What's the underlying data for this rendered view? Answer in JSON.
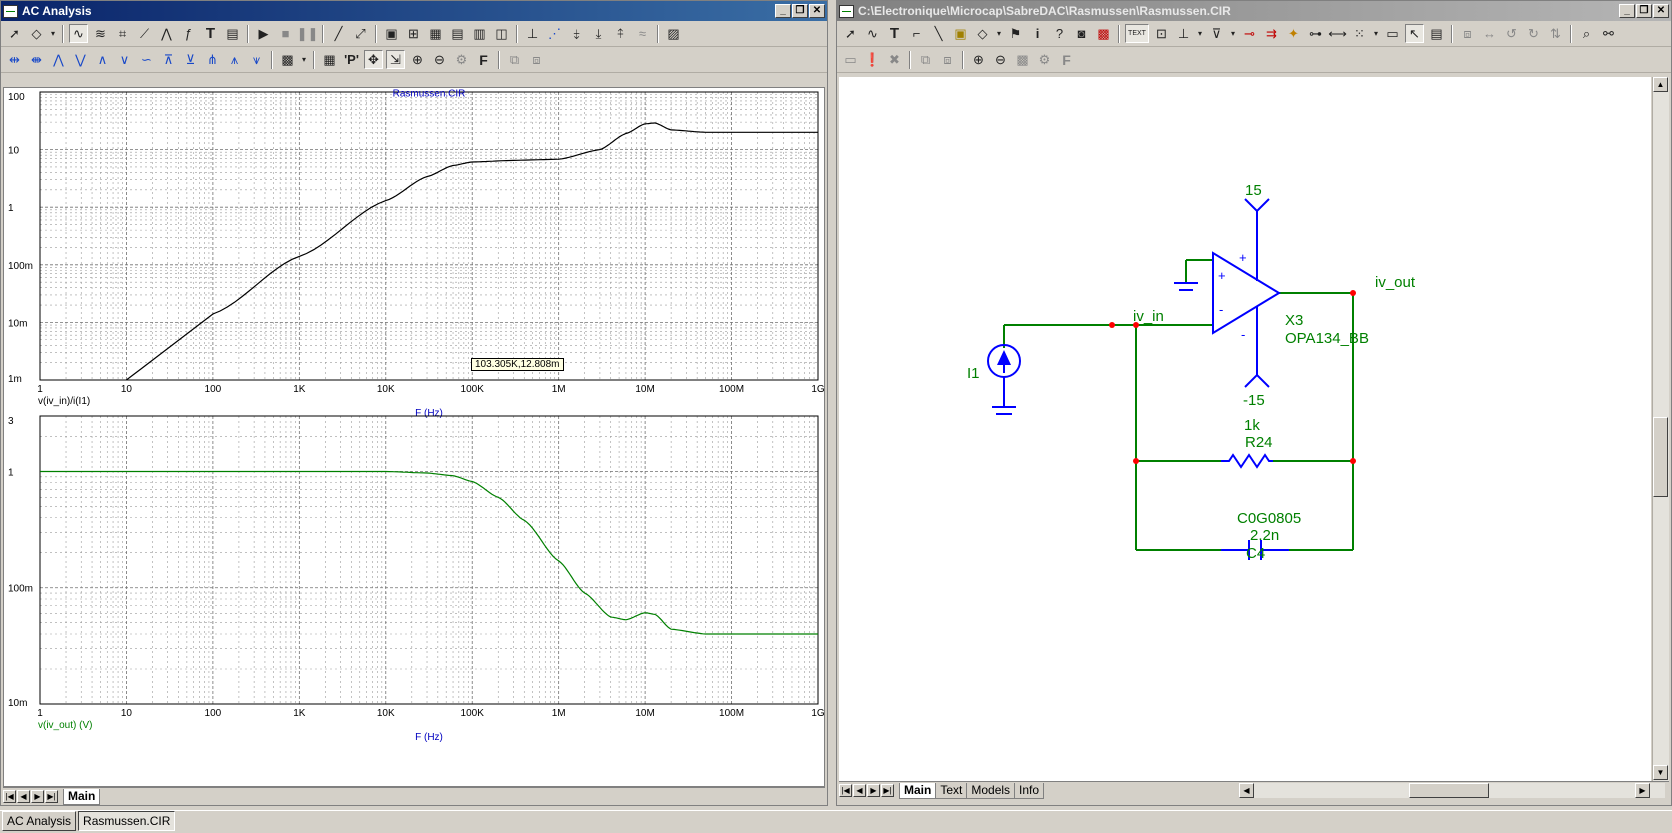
{
  "left_window": {
    "title": "AC Analysis",
    "buttons": {
      "minimize": "_",
      "restore": "❐",
      "close": "✕"
    },
    "tabs": [
      {
        "label": "Main"
      }
    ],
    "cursor_readout": "103.305K,12.808m"
  },
  "right_window": {
    "title": "C:\\Electronique\\Microcap\\SabreDAC\\Rasmussen\\Rasmussen.CIR",
    "buttons": {
      "minimize": "_",
      "restore": "❐",
      "close": "✕"
    },
    "tabs": [
      {
        "label": "Main"
      },
      {
        "label": "Text"
      },
      {
        "label": "Models"
      },
      {
        "label": "Info"
      }
    ],
    "toolbar_text_button": "TEXT"
  },
  "schematic": {
    "vplus": "15",
    "vminus": "-15",
    "plus_pin": "+",
    "minus_pin": "-",
    "in_plus": "+",
    "in_minus": "-",
    "opamp_name": "X3",
    "opamp_model": "OPA134_BB",
    "node_in": "iv_in",
    "node_out": "iv_out",
    "source_name": "I1",
    "r_value": "1k",
    "r_name": "R24",
    "c_model": "C0G0805",
    "c_value": "2.2n",
    "c_name": "C4",
    "colors": {
      "wire": "#008000",
      "component": "#0000ff",
      "node": "#ff0000"
    }
  },
  "chart_data": [
    {
      "type": "line",
      "title": "Rasmussen.CIR",
      "xlabel": "F (Hz)",
      "ylabel": "v(iv_in)/i(I1)",
      "xscale": "log",
      "yscale": "log",
      "xlim": [
        1,
        1000000000
      ],
      "ylim": [
        0.001,
        100
      ],
      "x_ticks": [
        "1",
        "10",
        "100",
        "1K",
        "10K",
        "100K",
        "1M",
        "10M",
        "100M",
        "1G"
      ],
      "y_ticks": [
        "100",
        "10",
        "1",
        "100m",
        "10m",
        "1m"
      ],
      "grid": true,
      "series": [
        {
          "color": "#000000",
          "x": [
            10,
            100,
            1000,
            10000,
            30000,
            60000,
            100000,
            300000,
            1000000,
            3000000,
            6000000,
            10000000,
            13000000,
            20000000,
            50000000,
            1000000000
          ],
          "y": [
            0.001,
            0.014,
            0.14,
            1.3,
            3.4,
            5.3,
            6.1,
            6.5,
            6.8,
            10,
            19,
            28,
            29,
            22,
            20,
            20
          ]
        }
      ]
    },
    {
      "type": "line",
      "title": "",
      "xlabel": "F (Hz)",
      "ylabel": "v(iv_out) (V)",
      "xscale": "log",
      "yscale": "log",
      "xlim": [
        1,
        1000000000
      ],
      "ylim": [
        0.01,
        3
      ],
      "x_ticks": [
        "1",
        "10",
        "100",
        "1K",
        "10K",
        "100K",
        "1M",
        "10M",
        "100M",
        "1G"
      ],
      "y_ticks": [
        "3",
        "1",
        "100m",
        "10m"
      ],
      "grid": true,
      "series": [
        {
          "color": "#008000",
          "x": [
            1,
            10000,
            30000,
            60000,
            100000,
            200000,
            400000,
            1000000,
            2000000,
            4000000,
            6000000,
            10000000,
            13000000,
            20000000,
            50000000,
            1000000000
          ],
          "y": [
            1.0,
            1.0,
            0.97,
            0.92,
            0.82,
            0.6,
            0.38,
            0.17,
            0.09,
            0.056,
            0.053,
            0.061,
            0.059,
            0.044,
            0.04,
            0.04
          ]
        }
      ]
    }
  ],
  "taskbar": [
    {
      "label": "AC Analysis"
    },
    {
      "label": "Rasmussen.CIR"
    }
  ]
}
